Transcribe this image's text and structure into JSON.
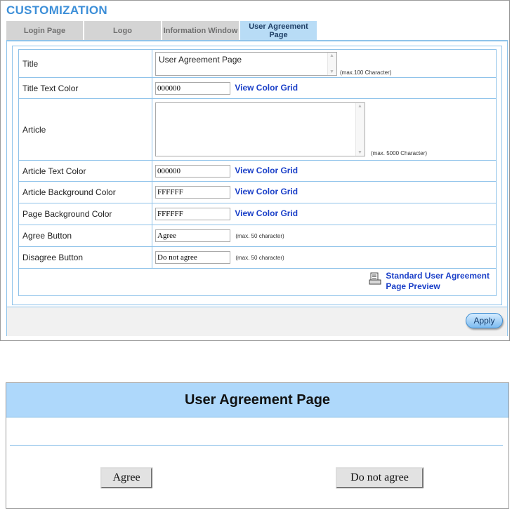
{
  "header": {
    "title": "CUSTOMIZATION"
  },
  "tabs": [
    {
      "label": "Login Page",
      "active": false
    },
    {
      "label": "Logo",
      "active": false
    },
    {
      "label": "Information Window",
      "active": false
    },
    {
      "label": "User Agreement Page",
      "active": true
    }
  ],
  "form": {
    "title": {
      "label": "Title",
      "value": "User Agreement Page",
      "hint": "(max.100 Character)"
    },
    "title_text_color": {
      "label": "Title Text Color",
      "value": "000000",
      "link": "View Color Grid"
    },
    "article": {
      "label": "Article",
      "value": "",
      "hint": "(max. 5000 Character)"
    },
    "article_text_color": {
      "label": "Article Text Color",
      "value": "000000",
      "link": "View Color Grid"
    },
    "article_bg_color": {
      "label": "Article Background Color",
      "value": "FFFFFF",
      "link": "View Color Grid"
    },
    "page_bg_color": {
      "label": "Page Background Color",
      "value": "FFFFFF",
      "link": "View Color Grid"
    },
    "agree_button": {
      "label": "Agree Button",
      "value": "Agree",
      "hint": "(max. 50 character)"
    },
    "disagree_button": {
      "label": "Disagree Button",
      "value": "Do not agree",
      "hint": "(max. 50 character)"
    },
    "preview_link": {
      "line1": "Standard User Agreement",
      "line2": "Page Preview",
      "icon": "document-icon"
    }
  },
  "footer": {
    "apply_label": "Apply"
  },
  "preview": {
    "title": "User Agreement Page",
    "agree_label": "Agree",
    "disagree_label": "Do not agree"
  },
  "colors": {
    "heading": "#3d8fd8",
    "accent_border": "#8fc3ea",
    "active_tab": "#b8dcf6",
    "link": "#1a3fc8",
    "preview_title_bg": "#aed8fb"
  }
}
